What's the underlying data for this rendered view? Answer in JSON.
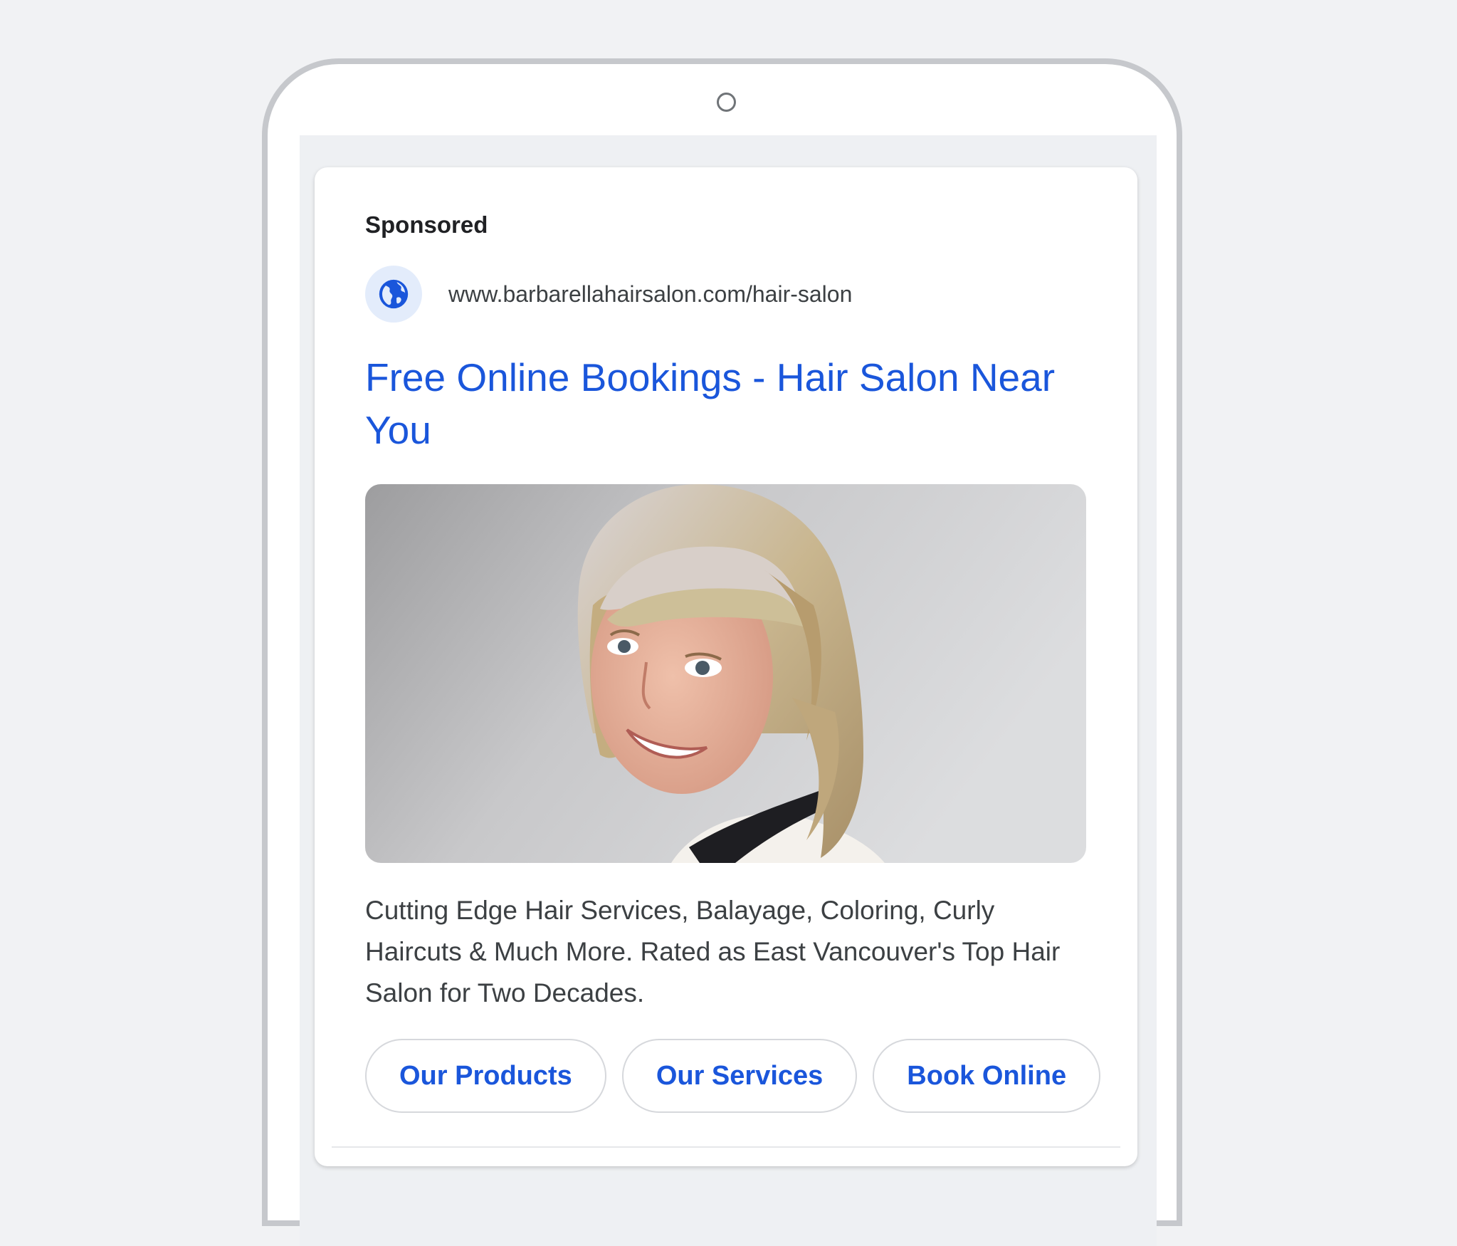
{
  "ad": {
    "label": "Sponsored",
    "icon": "globe-icon",
    "display_url": "www.barbarellahairsalon.com/hair-salon",
    "headline": "Free Online Bookings - Hair Salon Near You",
    "image": "hair-salon-portrait",
    "description": "Cutting Edge Hair Services, Balayage, Coloring, Curly Haircuts & Much More. Rated as East Vancouver's Top Hair Salon for Two Decades.",
    "sitelinks": [
      {
        "label": "Our Products"
      },
      {
        "label": "Our Services"
      },
      {
        "label": "Book Online"
      }
    ]
  },
  "colors": {
    "link_blue": "#1a56db",
    "badge_bg": "#e3ecfb",
    "device_frame": "#c6c8cc",
    "page_bg": "#f1f2f4"
  }
}
